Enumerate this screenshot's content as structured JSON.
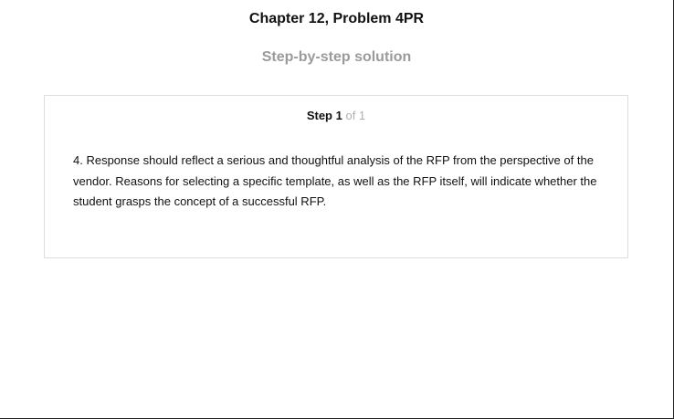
{
  "page": {
    "title": "Chapter 12, Problem 4PR",
    "subtitle": "Step-by-step solution"
  },
  "step": {
    "label": "Step 1",
    "of": "of 1",
    "text": "4. Response should reflect a serious and thoughtful analysis of the RFP from the perspective of the vendor. Reasons for selecting a specific template, as well as the RFP itself, will indicate whether the student grasps the concept of a successful RFP."
  }
}
